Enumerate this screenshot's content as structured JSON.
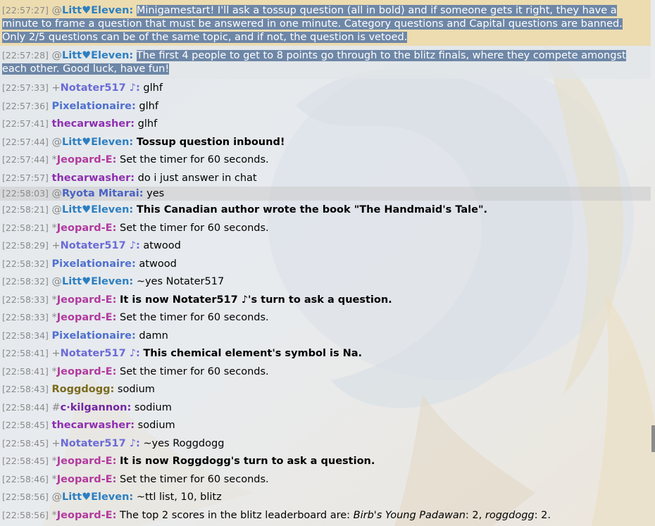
{
  "colors": {
    "LittvEleven": "#2d7fc1",
    "Notater517": "#6b6bd6",
    "Pixelationaire": "#4f70cf",
    "thecarwasher": "#8f2fb0",
    "Jeopard-E": "#b23a9e",
    "RyotaMitarai": "#4a63c4",
    "Roggdogg": "#7a6a1d",
    "ckilgannon": "#7426a3"
  },
  "messages": [
    {
      "ts": "[22:57:27]",
      "rank": "@",
      "user": "Litt♥Eleven:",
      "ckey": "LittvEleven",
      "text": "Minigamestart! I'll ask a tossup question (all in bold) and if someone gets it right, they have a minute to frame a question that must be answered in one minute. Category questions and Capital questions are banned. Only 2/5 questions can be of the same topic, and if not, the question is vetoed.",
      "style": "announce"
    },
    {
      "ts": "[22:57:28]",
      "rank": "@",
      "user": "Litt♥Eleven:",
      "ckey": "LittvEleven",
      "text": "The first 4 people to get to 8 points go through to the blitz finals, where they compete amongst each other. Good luck, have fun!",
      "style": "announce2"
    },
    {
      "ts": "[22:57:33]",
      "rank": "+",
      "user": "Notater517 ♪:",
      "ckey": "Notater517",
      "text": "glhf"
    },
    {
      "ts": "[22:57:36]",
      "rank": "",
      "user": "Pixelationaire:",
      "ckey": "Pixelationaire",
      "text": "glhf"
    },
    {
      "ts": "[22:57:41]",
      "rank": "",
      "user": "thecarwasher:",
      "ckey": "thecarwasher",
      "text": "glhf"
    },
    {
      "ts": "[22:57:44]",
      "rank": "@",
      "user": "Litt♥Eleven:",
      "ckey": "LittvEleven",
      "text": "Tossup question inbound!",
      "bold": true
    },
    {
      "ts": "[22:57:44]",
      "rank": "*",
      "user": "Jeopard-E:",
      "ckey": "Jeopard-E",
      "text": "Set the timer for 60 seconds."
    },
    {
      "ts": "[22:57:57]",
      "rank": "",
      "user": "thecarwasher:",
      "ckey": "thecarwasher",
      "text": "do i just answer in chat"
    },
    {
      "ts": "[22:58:03]",
      "rank": "@",
      "user": "Ryota Mitarai:",
      "ckey": "RyotaMitarai",
      "text": "yes",
      "style": "highlight"
    },
    {
      "ts": "[22:58:21]",
      "rank": "@",
      "user": "Litt♥Eleven:",
      "ckey": "LittvEleven",
      "text": "This Canadian author wrote the book \"The Handmaid's Tale\".",
      "bold": true
    },
    {
      "ts": "[22:58:21]",
      "rank": "*",
      "user": "Jeopard-E:",
      "ckey": "Jeopard-E",
      "text": "Set the timer for 60 seconds."
    },
    {
      "ts": "[22:58:29]",
      "rank": "+",
      "user": "Notater517 ♪:",
      "ckey": "Notater517",
      "text": "atwood"
    },
    {
      "ts": "[22:58:32]",
      "rank": "",
      "user": "Pixelationaire:",
      "ckey": "Pixelationaire",
      "text": "atwood"
    },
    {
      "ts": "[22:58:32]",
      "rank": "@",
      "user": "Litt♥Eleven:",
      "ckey": "LittvEleven",
      "text": "~yes Notater517"
    },
    {
      "ts": "[22:58:33]",
      "rank": "*",
      "user": "Jeopard-E:",
      "ckey": "Jeopard-E",
      "text": "It is now Notater517 ♪'s turn to ask a question.",
      "bold": true
    },
    {
      "ts": "[22:58:33]",
      "rank": "*",
      "user": "Jeopard-E:",
      "ckey": "Jeopard-E",
      "text": "Set the timer for 60 seconds."
    },
    {
      "ts": "[22:58:34]",
      "rank": "",
      "user": "Pixelationaire:",
      "ckey": "Pixelationaire",
      "text": "damn"
    },
    {
      "ts": "[22:58:41]",
      "rank": "+",
      "user": "Notater517 ♪:",
      "ckey": "Notater517",
      "text": "This chemical element's symbol is Na.",
      "bold": true
    },
    {
      "ts": "[22:58:41]",
      "rank": "*",
      "user": "Jeopard-E:",
      "ckey": "Jeopard-E",
      "text": "Set the timer for 60 seconds."
    },
    {
      "ts": "[22:58:43]",
      "rank": "",
      "user": "Roggdogg:",
      "ckey": "Roggdogg",
      "text": "sodium"
    },
    {
      "ts": "[22:58:44]",
      "rank": "#",
      "user": "c·kilgannon:",
      "ckey": "ckilgannon",
      "text": "sodium"
    },
    {
      "ts": "[22:58:45]",
      "rank": "",
      "user": "thecarwasher:",
      "ckey": "thecarwasher",
      "text": "sodium"
    },
    {
      "ts": "[22:58:45]",
      "rank": "+",
      "user": "Notater517 ♪:",
      "ckey": "Notater517",
      "text": "~yes Roggdogg"
    },
    {
      "ts": "[22:58:45]",
      "rank": "*",
      "user": "Jeopard-E:",
      "ckey": "Jeopard-E",
      "text": "It is now Roggdogg's turn to ask a question.",
      "bold": true
    },
    {
      "ts": "[22:58:46]",
      "rank": "*",
      "user": "Jeopard-E:",
      "ckey": "Jeopard-E",
      "text": "Set the timer for 60 seconds."
    },
    {
      "ts": "[22:58:56]",
      "rank": "@",
      "user": "Litt♥Eleven:",
      "ckey": "LittvEleven",
      "text": "~ttl list, 10, blitz"
    },
    {
      "ts": "[22:58:56]",
      "rank": "*",
      "user": "Jeopard-E:",
      "ckey": "Jeopard-E",
      "parts": [
        {
          "t": "The top 2 scores in the blitz leaderboard are: "
        },
        {
          "t": "Birb's Young Padawan",
          "i": true
        },
        {
          "t": ": 2, "
        },
        {
          "t": "roggdogg",
          "i": true
        },
        {
          "t": ": 2."
        }
      ]
    }
  ]
}
